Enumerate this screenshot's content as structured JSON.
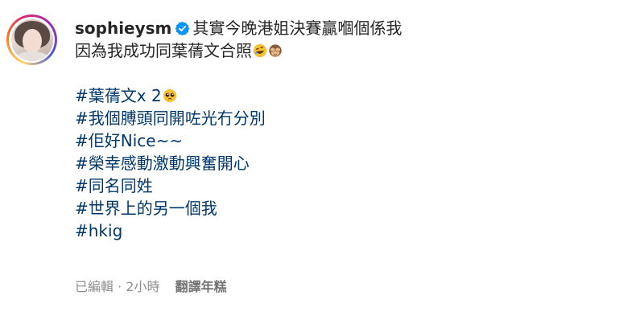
{
  "post": {
    "username": "sophieysm",
    "caption_line1": "其實今晚港姐決賽贏嗰個係我",
    "caption_line2": "因為我成功同葉蒨文合照",
    "hashtags": [
      "#葉蒨文x 2",
      "#我個膊頭同開咗光冇分別",
      "#佢好Nice~~",
      "#榮幸感動激動興奮開心",
      "#同名同姓",
      "#世界上的另一個我",
      "#hkig"
    ],
    "edited_label": "已編輯",
    "separator": "·",
    "time_ago": "2小時",
    "translate_label": "翻譯年糕"
  },
  "icons": {
    "avatar": "profile-avatar",
    "verified": "verified-badge-icon",
    "emoji_1": "rolling-laughing-emoji",
    "emoji_2": "see-no-evil-monkey-emoji",
    "emoji_3": "pleading-face-emoji"
  },
  "colors": {
    "text": "#262626",
    "hashtag": "#00376b",
    "meta": "#8e8e8e",
    "verified": "#0095f6"
  }
}
